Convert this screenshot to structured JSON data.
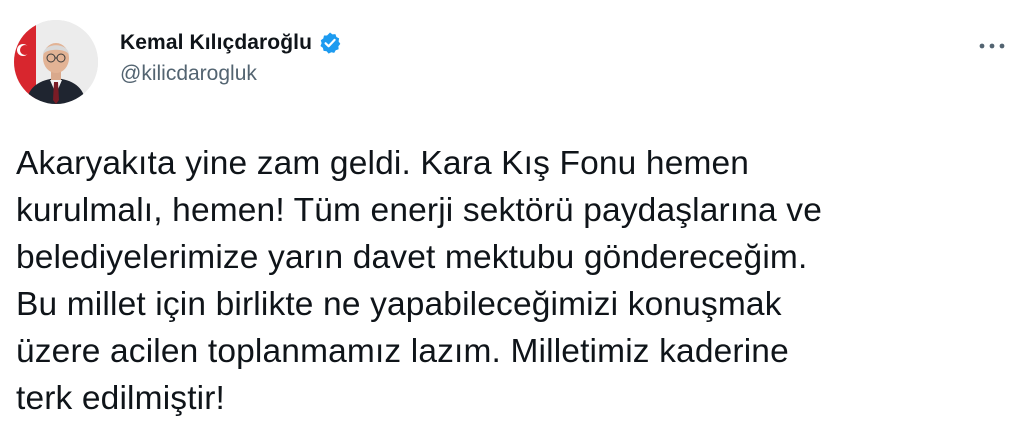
{
  "tweet": {
    "author": {
      "display_name": "Kemal Kılıçdaroğlu",
      "handle": "@kilicdarogluk",
      "verified": true,
      "avatar_icon": "profile-photo"
    },
    "more_icon": "more-horizontal-icon",
    "text": "Akaryakıta yine zam geldi. Kara Kış Fonu hemen\nkurulmalı, hemen! Tüm enerji sektörü paydaşlarına ve\nbelediyelerimize yarın davet mektubu göndereceğim.\nBu millet için birlikte ne yapabileceğimizi konuşmak\nüzere acilen toplanmamız lazım. Milletimiz kaderine\nterk edilmiştir!"
  },
  "colors": {
    "verified_blue": "#1d9bf0",
    "text_primary": "#0f1419",
    "text_secondary": "#536471"
  }
}
